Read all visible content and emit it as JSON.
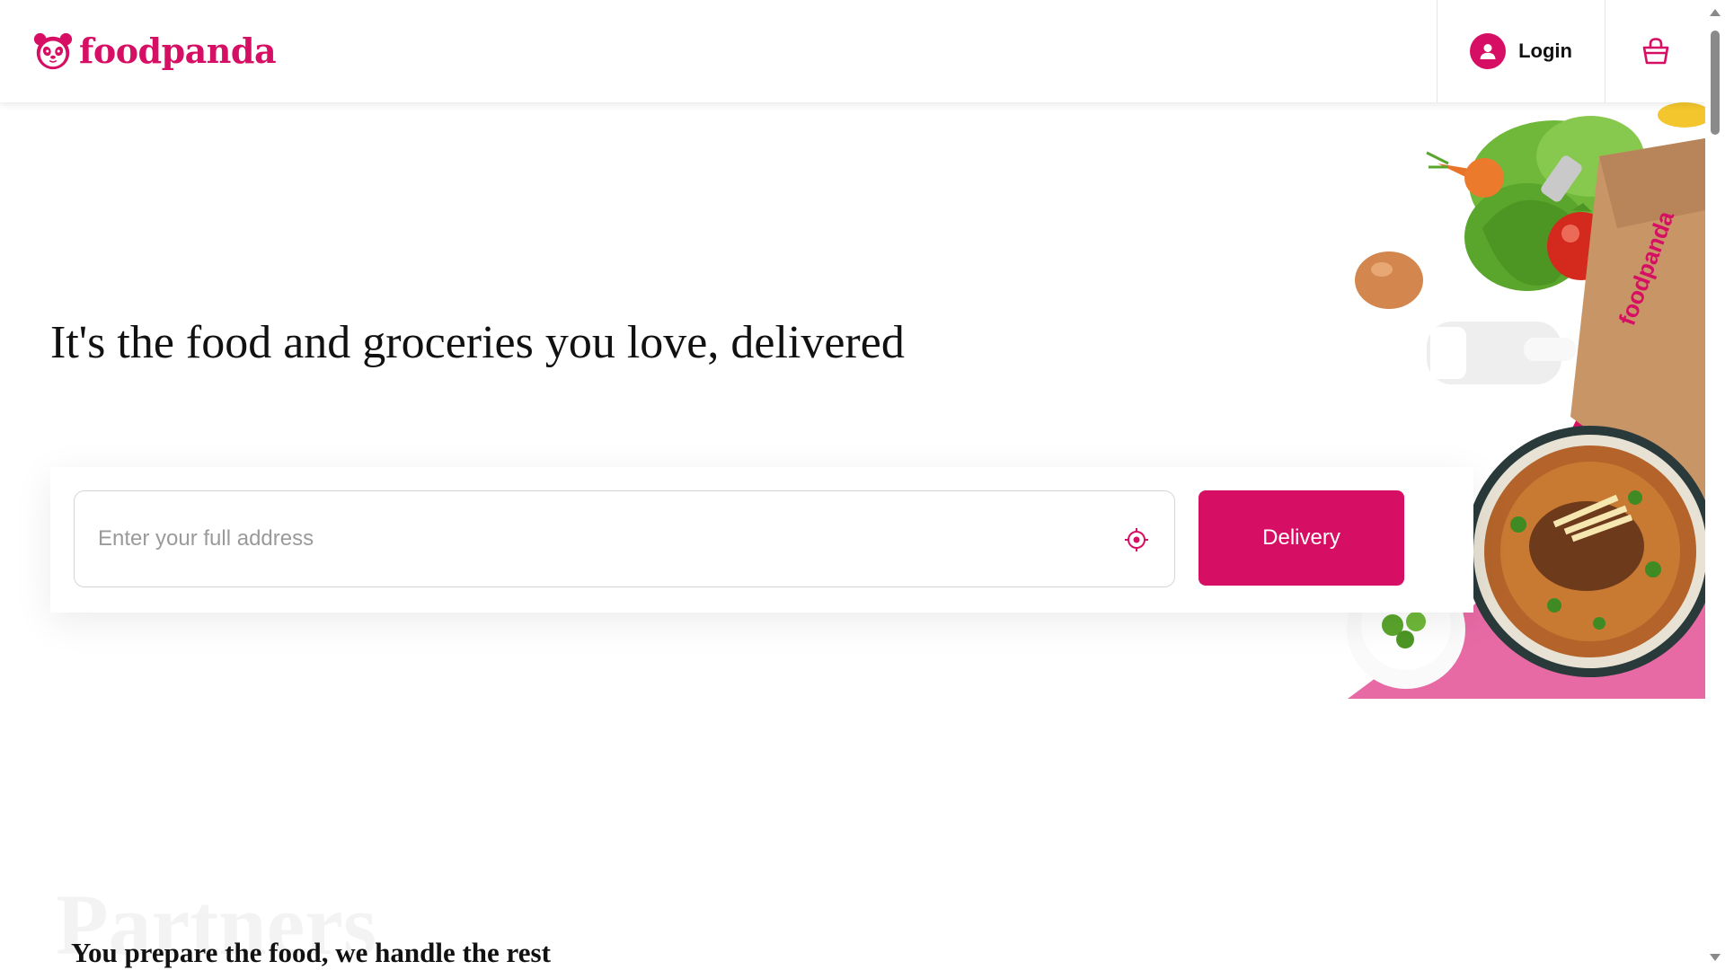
{
  "brand": {
    "name": "foodpanda",
    "color": "#d70f64"
  },
  "header": {
    "login_label": "Login",
    "cart_icon": "shopping-bag-icon",
    "avatar_icon": "user-avatar-icon"
  },
  "hero": {
    "title": "It's the food and groceries you love, delivered",
    "address_placeholder": "Enter your full address",
    "locate_icon": "target-location-icon",
    "delivery_label": "Delivery",
    "bag_text": "foodpanda"
  },
  "partners": {
    "watermark": "Partners",
    "subtitle": "You prepare the food, we handle the rest"
  }
}
